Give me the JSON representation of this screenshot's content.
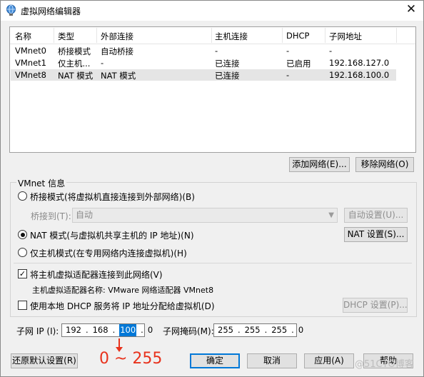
{
  "window": {
    "title": "虚拟网络编辑器"
  },
  "table": {
    "headers": [
      "名称",
      "类型",
      "外部连接",
      "主机连接",
      "DHCP",
      "子网地址"
    ],
    "rows": [
      [
        "VMnet0",
        "桥接模式",
        "自动桥接",
        "-",
        "-",
        "-"
      ],
      [
        "VMnet1",
        "仅主机...",
        "-",
        "已连接",
        "已启用",
        "192.168.127.0"
      ],
      [
        "VMnet8",
        "NAT 模式",
        "NAT 模式",
        "已连接",
        "-",
        "192.168.100.0"
      ]
    ],
    "selected_row": 2
  },
  "buttons": {
    "add_network": "添加网络(E)...",
    "remove_network": "移除网络(O)",
    "auto_settings": "自动设置(U)...",
    "nat_settings": "NAT 设置(S)...",
    "dhcp_settings": "DHCP 设置(P)...",
    "restore_defaults": "还原默认设置(R)",
    "ok": "确定",
    "cancel": "取消",
    "apply": "应用(A)",
    "help": "帮助"
  },
  "vmnet_info": {
    "group_title": "VMnet 信息",
    "bridged_label": "桥接模式(将虚拟机直接连接到外部网络)(B)",
    "bridged_to_label": "桥接到(T):",
    "bridged_to_value": "自动",
    "nat_label": "NAT 模式(与虚拟机共享主机的 IP 地址)(N)",
    "hostonly_label": "仅主机模式(在专用网络内连接虚拟机)(H)",
    "selected_mode": "nat",
    "connect_adapter_label": "将主机虚拟适配器连接到此网络(V)",
    "connect_adapter_checked": true,
    "adapter_name_text": "主机虚拟适配器名称: VMware 网络适配器 VMnet8",
    "use_dhcp_label": "使用本地 DHCP 服务将 IP 地址分配给虚拟机(D)",
    "use_dhcp_checked": false
  },
  "subnet": {
    "ip_label": "子网 IP (I):",
    "ip_octets": [
      "192",
      "168",
      "100",
      "0"
    ],
    "selected_octet": 2,
    "mask_label": "子网掩码(M):",
    "mask_octets": [
      "255",
      "255",
      "255",
      "0"
    ]
  },
  "annotation": {
    "text": "0 ~ 255",
    "color": "#e8321c"
  },
  "watermark": "@51CTO博客",
  "icons": {
    "app": "network-globe-icon",
    "close": "close-icon",
    "dropdown": "chevron-down-icon"
  }
}
